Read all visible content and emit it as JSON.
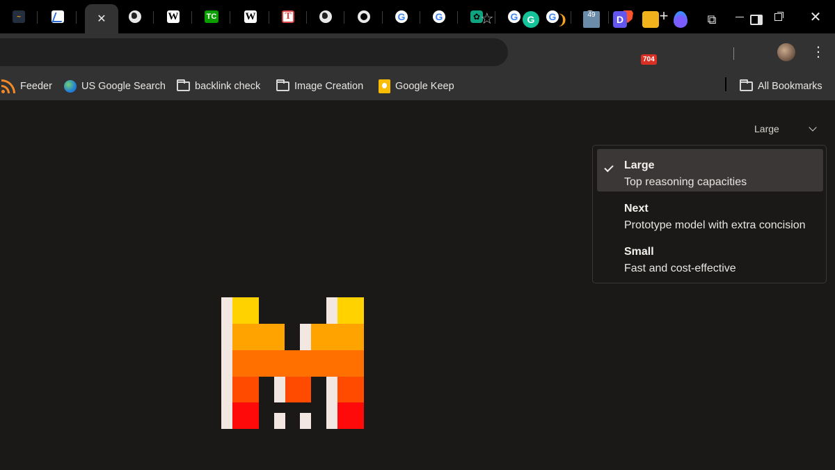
{
  "tabs": [
    {
      "icon": "amazon-icon",
      "glyph": "~"
    },
    {
      "icon": "chart-icon",
      "glyph": ""
    },
    {
      "icon": "close-icon",
      "glyph": "✕",
      "active": true
    },
    {
      "icon": "globe-icon",
      "glyph": ""
    },
    {
      "icon": "wikipedia-icon",
      "glyph": "W"
    },
    {
      "icon": "techcrunch-icon",
      "glyph": "TC"
    },
    {
      "icon": "wikipedia-icon",
      "glyph": "W"
    },
    {
      "icon": "t-icon",
      "glyph": "T"
    },
    {
      "icon": "globe-icon",
      "glyph": ""
    },
    {
      "icon": "chrome-icon",
      "glyph": ""
    },
    {
      "icon": "google-icon",
      "glyph": "G"
    },
    {
      "icon": "google-icon",
      "glyph": "G"
    },
    {
      "icon": "chatgpt-icon",
      "glyph": "✿"
    },
    {
      "icon": "google-icon",
      "glyph": "G"
    },
    {
      "icon": "google-icon",
      "glyph": "G"
    },
    {
      "icon": "chrome-icon",
      "glyph": ""
    },
    {
      "icon": "brave-icon",
      "glyph": ""
    }
  ],
  "toolbar": {
    "new_tab_glyph": "+",
    "extensions": {
      "grammarly": "G",
      "counter_49": "49",
      "d_ext": "D",
      "badge_704": "704"
    }
  },
  "bookmarks": [
    {
      "label": "Feeder",
      "icon": "rss-icon"
    },
    {
      "label": "US Google Search",
      "icon": "globe-icon"
    },
    {
      "label": "backlink check",
      "icon": "folder-icon"
    },
    {
      "label": "Image Creation",
      "icon": "folder-icon"
    },
    {
      "label": "Google Keep",
      "icon": "keep-icon"
    }
  ],
  "all_bookmarks_label": "All Bookmarks",
  "model_selector": {
    "current": "Large",
    "options": [
      {
        "title": "Large",
        "description": "Top reasoning capacities",
        "selected": true
      },
      {
        "title": "Next",
        "description": "Prototype model with extra concision",
        "selected": false
      },
      {
        "title": "Small",
        "description": "Fast and cost-effective",
        "selected": false
      }
    ]
  },
  "colors": {
    "background": "#1b1917",
    "logo_yellow": "#ffd200",
    "logo_amber": "#ffa300",
    "logo_orange": "#ff7000",
    "logo_red_orange": "#ff4b00",
    "logo_red": "#ff0a0a",
    "logo_white": "#f2e8e1"
  }
}
